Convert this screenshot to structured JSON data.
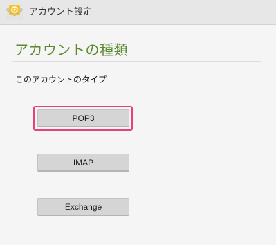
{
  "action_bar": {
    "title": "アカウント設定",
    "icon": "email-app-icon"
  },
  "main": {
    "heading": "アカウントの種類",
    "prompt": "このアカウントのタイプ",
    "account_types": [
      {
        "label": "POP3",
        "highlighted": true
      },
      {
        "label": "IMAP",
        "highlighted": false
      },
      {
        "label": "Exchange",
        "highlighted": false
      }
    ]
  },
  "colors": {
    "heading": "#5b8a31",
    "highlight": "#e8407a",
    "button": "#d5d5d5"
  }
}
